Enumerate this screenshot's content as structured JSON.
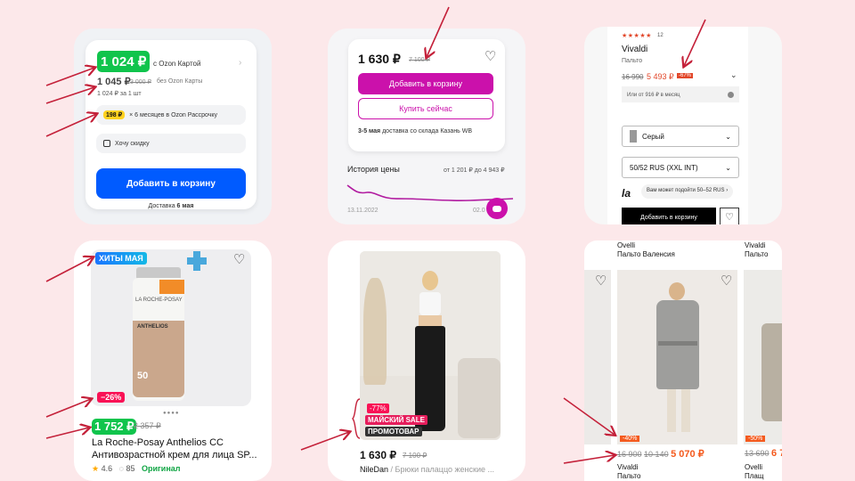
{
  "ozon": {
    "price_card": "1 024 ₽",
    "card_label": "с Ozon Картой",
    "price_regular": "1 045 ₽",
    "price_old": "3 000 ₽",
    "regular_label": "без Ozon Карты",
    "per_unit": "1 024 ₽ за 1 шт",
    "installment_price": "198 ₽",
    "installment_label": "× 6 месяцев в Ozon Рассрочку",
    "discount_label": "Хочу скидку",
    "add_to_cart": "Добавить в корзину",
    "delivery_prefix": "Доставка",
    "delivery_date": "6 мая"
  },
  "wb": {
    "price": "1 630 ₽",
    "price_old": "7 100 ₽",
    "add_to_cart": "Добавить в корзину",
    "buy_now": "Купить сейчас",
    "delivery_date": "3-5 мая",
    "delivery_text": "доставка со склада Казань WB",
    "history_title": "История цены",
    "history_range": "от 1 201 ₽ до 4 943 ₽",
    "history_start_date": "13.11.2022",
    "history_end_date": "02.0"
  },
  "lamoda": {
    "rating_count": "12",
    "brand": "Vivaldi",
    "category": "Пальто",
    "price_old": "16 990",
    "price": "5 493 ₽",
    "discount": "-67%",
    "installment": "Или от 916 ₽ в месяц",
    "color": "Серый",
    "size": "50/52 RUS (XXL INT)",
    "logo": "la",
    "fit_hint": "Вам может подойти 50–52 RUS",
    "add_to_cart": "Добавить в корзину"
  },
  "cosmetics": {
    "hit_badge": "ХИТЫ МАЯ",
    "discount": "−26%",
    "price": "1 752 ₽",
    "price_old": "2 357 ₽",
    "title_line1": "La Roche-Posay Anthelios CC",
    "title_line2": "Антивозрастной крем для лица SP...",
    "rating": "4.6",
    "reviews": "85",
    "original": "Оригинал",
    "bottle_brand": "LA ROCHE-POSAY",
    "bottle_name": "ANTHELIOS",
    "bottle_spf": "50"
  },
  "trousers": {
    "discount": "-77%",
    "sale_badge": "МАЙСКИЙ SALE",
    "promo_badge": "ПРОМОТОВАР",
    "price": "1 630 ₽",
    "price_old": "7 100 ₽",
    "seller": "NileDan",
    "title": "Брюки палаццо женские ..."
  },
  "coats": {
    "top_left_brand": "Ovelli",
    "top_left_name": "Пальто Валенсия",
    "top_right_brand": "Vivaldi",
    "top_right_name": "Пальто",
    "discount_main": "-40%",
    "discount_side": "-50%",
    "price_old1": "16 900",
    "price_old2": "10 140",
    "price": "5 070 ₽",
    "side_price_old": "13 690",
    "side_price": "6 7",
    "bottom_left_brand": "Vivaldi",
    "bottom_left_name": "Пальто",
    "bottom_right_brand": "Ovelli",
    "bottom_right_name": "Плащ"
  },
  "colors": {
    "ozon_blue": "#005bff",
    "wb_purple": "#cb11ab",
    "ozon_green": "#10c44c",
    "sale_red": "#f91155",
    "arrow_red": "#c4213a"
  }
}
